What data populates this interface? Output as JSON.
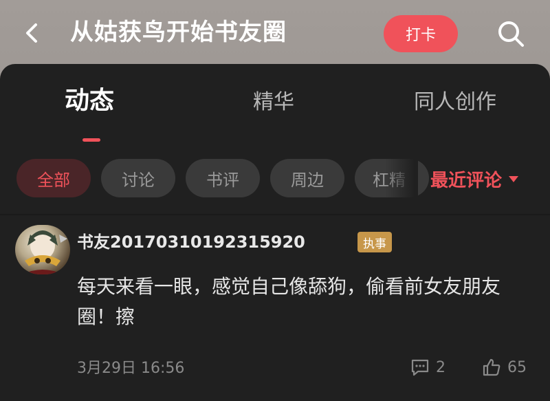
{
  "header": {
    "title": "从姑获鸟开始书友圈",
    "checkin_label": "打卡",
    "back_icon": "chevron-left-icon",
    "search_icon": "search-icon"
  },
  "tabs": [
    {
      "label": "动态",
      "active": true
    },
    {
      "label": "精华",
      "active": false
    },
    {
      "label": "同人创作",
      "active": false
    }
  ],
  "filters": {
    "chips": [
      {
        "label": "全部",
        "active": true
      },
      {
        "label": "讨论",
        "active": false
      },
      {
        "label": "书评",
        "active": false
      },
      {
        "label": "周边",
        "active": false
      },
      {
        "label": "杠精",
        "active": false
      }
    ],
    "sort_label": "最近评论"
  },
  "post": {
    "username": "书友20170310192315920",
    "badge": "执事",
    "content": "每天来看一眼，感觉自己像舔狗，偷看前女友朋友圈！擦",
    "time": "3月29日 16:56",
    "comment_count": "2",
    "like_count": "65"
  },
  "colors": {
    "accent": "#f0525a",
    "panel_bg": "#202020",
    "badge_bg": "#c7974a"
  }
}
